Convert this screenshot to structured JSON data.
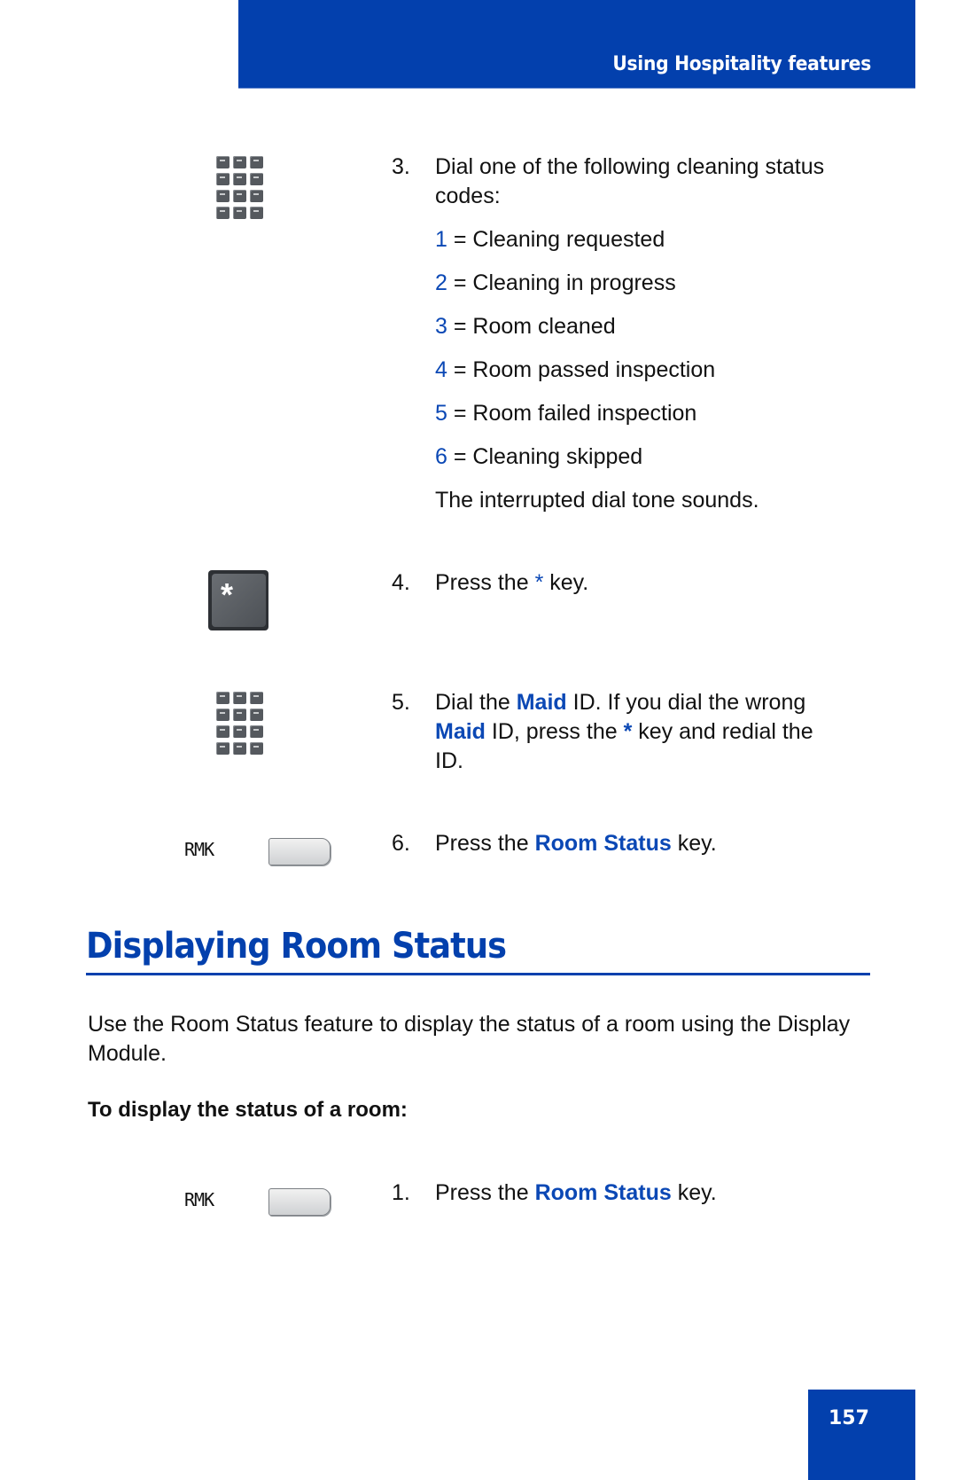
{
  "header": {
    "title": "Using Hospitality features"
  },
  "steps_top": [
    {
      "number": "3.",
      "text_lines": [
        "Dial one of the following cleaning status",
        "codes:"
      ],
      "icon": "keypad-icon",
      "codes": [
        {
          "code": "1",
          "label": "= Cleaning requested"
        },
        {
          "code": "2",
          "label": "= Cleaning in progress"
        },
        {
          "code": "3",
          "label": "= Room cleaned"
        },
        {
          "code": "4",
          "label": "= Room passed inspection"
        },
        {
          "code": "5",
          "label": "= Room failed inspection"
        },
        {
          "code": "6",
          "label": "= Cleaning skipped"
        }
      ],
      "note": "The interrupted dial tone sounds."
    },
    {
      "number": "4.",
      "text_before": "Press the ",
      "highlight": "*",
      "text_after": " key.",
      "icon": "star-key-icon",
      "key_glyph": "*"
    },
    {
      "number": "5.",
      "line1_before": "Dial the ",
      "line1_highlight": "Maid",
      "line1_after": " ID. If you dial the wrong",
      "line2_highlight": "Maid",
      "line2_mid": " ID, press the ",
      "line2_star": "*",
      "line2_after": " key and redial the",
      "line3": "ID.",
      "icon": "keypad-icon"
    },
    {
      "number": "6.",
      "text_before": "Press the ",
      "highlight": "Room Status",
      "text_after": " key.",
      "softkey_label": "RMK"
    }
  ],
  "section": {
    "heading": "Displaying Room Status",
    "paragraph": "Use the Room Status feature to display the status of a room using the Display Module.",
    "subheading": "To display the status of a room:",
    "steps": [
      {
        "number": "1.",
        "text_before": "Press the ",
        "highlight": "Room Status",
        "text_after": " key.",
        "softkey_label": "RMK"
      }
    ]
  },
  "footer": {
    "page_number": "157"
  },
  "colors": {
    "brand_blue": "#0340ad",
    "highlight_blue": "#0b48b5",
    "text": "#111111"
  }
}
